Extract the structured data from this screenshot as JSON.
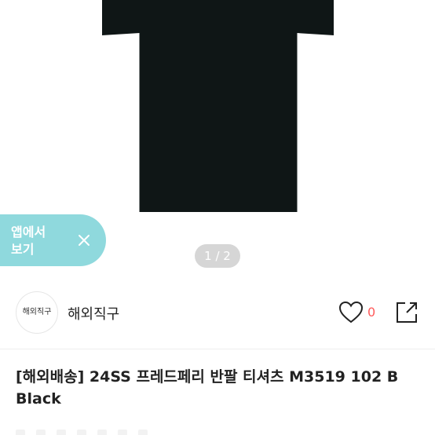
{
  "app_banner": {
    "label": "앱에서\n보기",
    "close_icon": "close-icon"
  },
  "gallery": {
    "pager": "1 / 2"
  },
  "seller": {
    "avatar_text": "해외직구",
    "name": "해외직구",
    "likes": "0"
  },
  "product": {
    "title": "[해외배송] 24SS 프레드페리 반팔 티셔츠 M3519 102 B Black"
  },
  "colors": {
    "banner": "#8fd9dd",
    "like": "#ff5a5a",
    "shirt": "#0f1616"
  }
}
